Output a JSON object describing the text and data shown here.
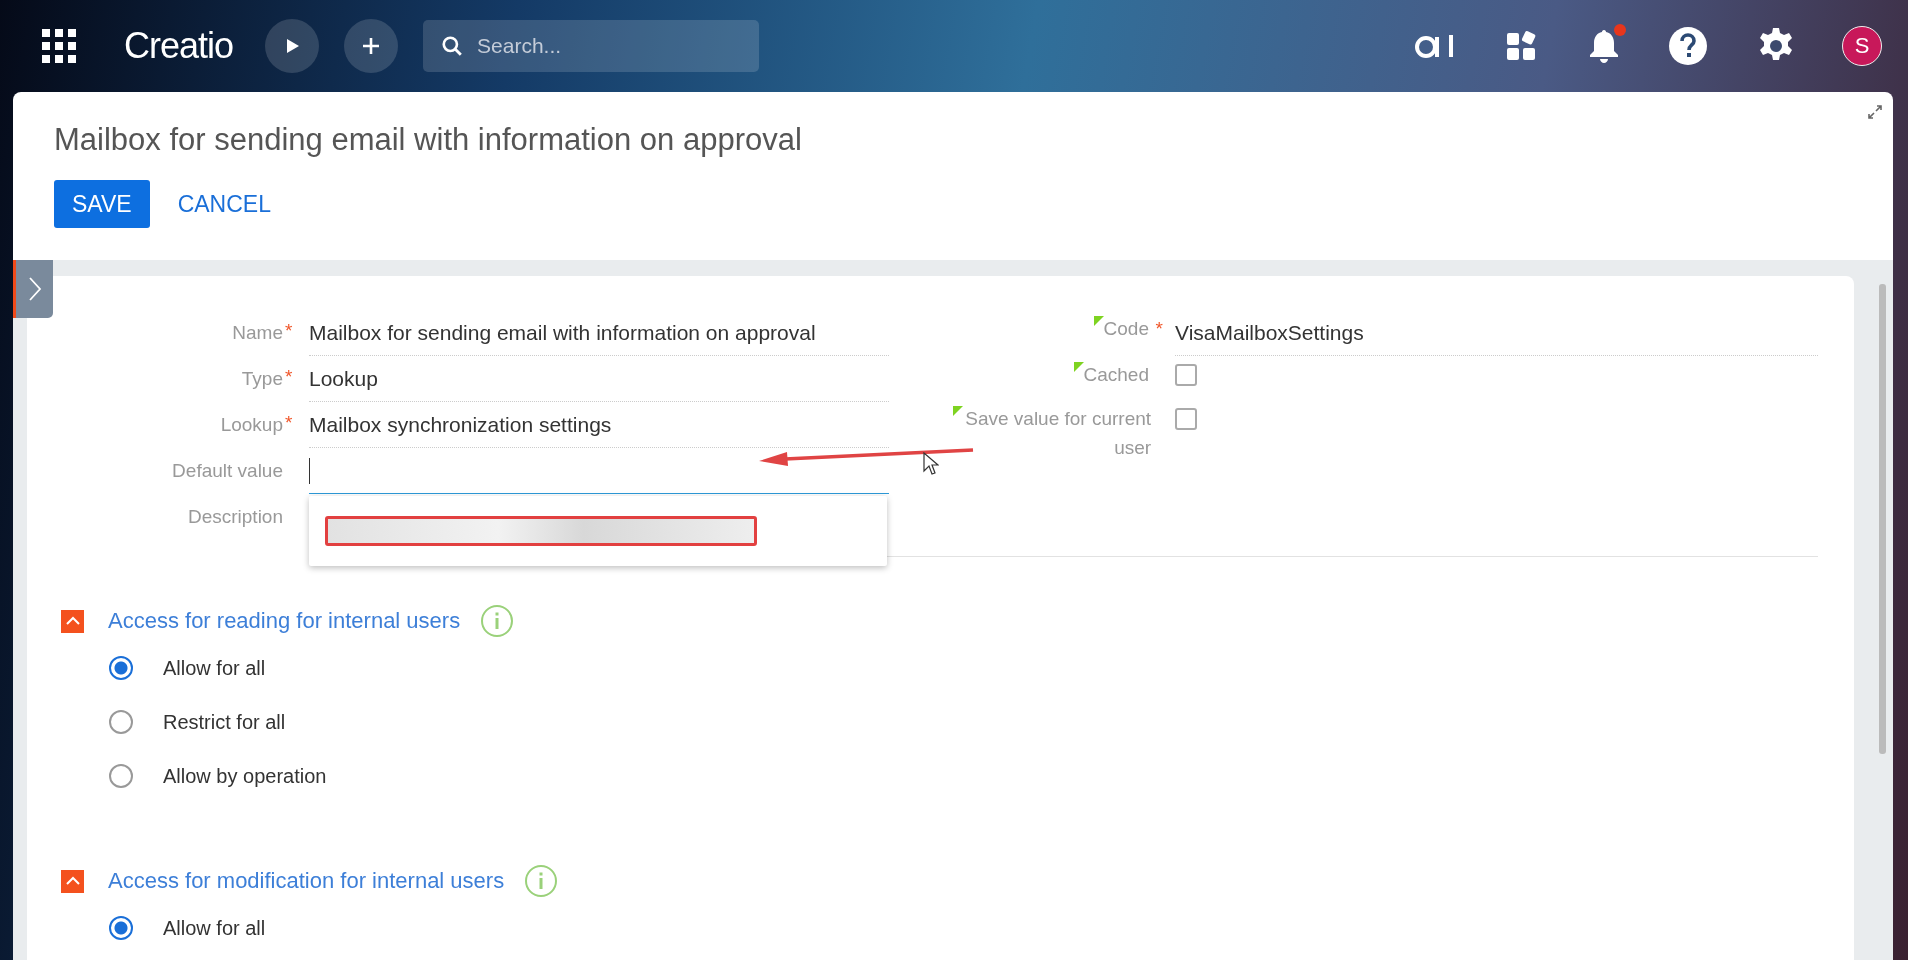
{
  "topbar": {
    "logo": "Creatio",
    "search": {
      "placeholder": "Search..."
    },
    "notification_unread": true,
    "avatar": "S"
  },
  "page": {
    "title": "Mailbox for sending email with information on approval",
    "buttons": [
      {
        "label": "SAVE",
        "kind": "primary"
      },
      {
        "label": "CANCEL",
        "kind": "link"
      }
    ]
  },
  "form": {
    "left": [
      {
        "label": "Name",
        "required_mark": "*",
        "value": "Mailbox for sending email with information on approval",
        "focused": false
      },
      {
        "label": "Type",
        "required_mark": "*",
        "value": "Lookup",
        "focused": false
      },
      {
        "label": "Lookup",
        "required_mark": "*",
        "value": "Mailbox synchronization settings",
        "focused": false
      },
      {
        "label": "Default value",
        "focused": true
      },
      {
        "label": "Description"
      }
    ],
    "right": [
      {
        "label": "Code",
        "required_mark": "*",
        "modified": true,
        "kind": "text",
        "value": "VisaMailboxSettings"
      },
      {
        "label": "Cached",
        "modified": true,
        "kind": "checkbox",
        "checked": false
      },
      {
        "label": "Save value for current user",
        "modified": true,
        "kind": "checkbox",
        "checked": false
      }
    ]
  },
  "dropdown": {
    "open": true
  },
  "sections": [
    {
      "title": "Access for reading for internal users",
      "expanded": true,
      "options": [
        {
          "label": "Allow for all",
          "selected": true
        },
        {
          "label": "Restrict for all",
          "selected": false
        },
        {
          "label": "Allow by operation",
          "selected": false
        }
      ]
    },
    {
      "title": "Access for modification for internal users",
      "expanded": true,
      "options": [
        {
          "label": "Allow for all",
          "selected": true
        }
      ]
    }
  ]
}
